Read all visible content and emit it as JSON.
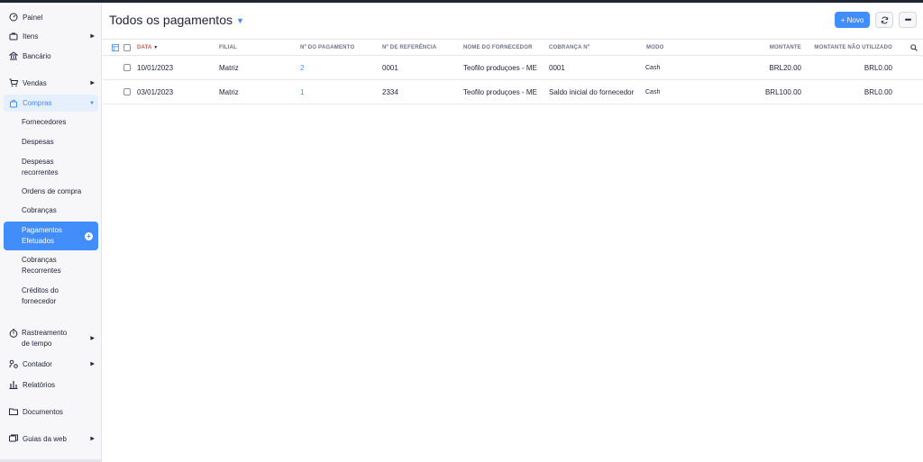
{
  "sidebar": {
    "items": [
      {
        "label": "Painel",
        "icon": "dashboard-icon"
      },
      {
        "label": "Itens",
        "icon": "bag-icon"
      },
      {
        "label": "Bancário",
        "icon": "bank-icon"
      },
      {
        "label": "Vendas",
        "icon": "cart-icon"
      },
      {
        "label": "Compras",
        "icon": "shopping-bag-icon"
      },
      {
        "label": "Rastreamento de tempo",
        "icon": "timer-icon"
      },
      {
        "label": "Contador",
        "icon": "accountant-icon"
      },
      {
        "label": "Relatórios",
        "icon": "reports-icon"
      },
      {
        "label": "Documentos",
        "icon": "folder-icon"
      },
      {
        "label": "Guias da web",
        "icon": "web-tabs-icon"
      }
    ],
    "compras_sub": [
      {
        "label": "Fornecedores"
      },
      {
        "label": "Despesas"
      },
      {
        "label": "Despesas recorrentes"
      },
      {
        "label": "Ordens de compra"
      },
      {
        "label": "Cobranças"
      },
      {
        "label": "Pagamentos Efetuados"
      },
      {
        "label": "Cobranças Recorrentes"
      },
      {
        "label": "Créditos do fornecedor"
      }
    ]
  },
  "header": {
    "title": "Todos os pagamentos",
    "new_label": "+ Novo",
    "more_label": "•••"
  },
  "table": {
    "columns": [
      "DATA",
      "FILIAL",
      "Nº DO PAGAMENTO",
      "Nº DE REFERÊNCIA",
      "NOME DO FORNECEDOR",
      "COBRANÇA Nº",
      "MODO",
      "MONTANTE",
      "MONTANTE NÃO UTILIZADO"
    ],
    "sort_indicator": "▼",
    "rows": [
      {
        "data": "10/01/2023",
        "filial": "Matriz",
        "pagamento": "2",
        "referencia": "0001",
        "fornecedor": "Teofilo produçoes - ME",
        "cobranca": "0001",
        "modo": "Cash",
        "montante": "BRL20.00",
        "nao_utilizado": "BRL0.00"
      },
      {
        "data": "03/01/2023",
        "filial": "Matriz",
        "pagamento": "1",
        "referencia": "2334",
        "fornecedor": "Teofilo produçoes - ME",
        "cobranca": "Saldo inicial do fornecedor",
        "modo": "Cash",
        "montante": "BRL100.00",
        "nao_utilizado": "BRL0.00"
      }
    ]
  },
  "colors": {
    "accent": "#408dfb",
    "sort": "#d9534f",
    "sidebar_bg": "#f7f7fa"
  }
}
